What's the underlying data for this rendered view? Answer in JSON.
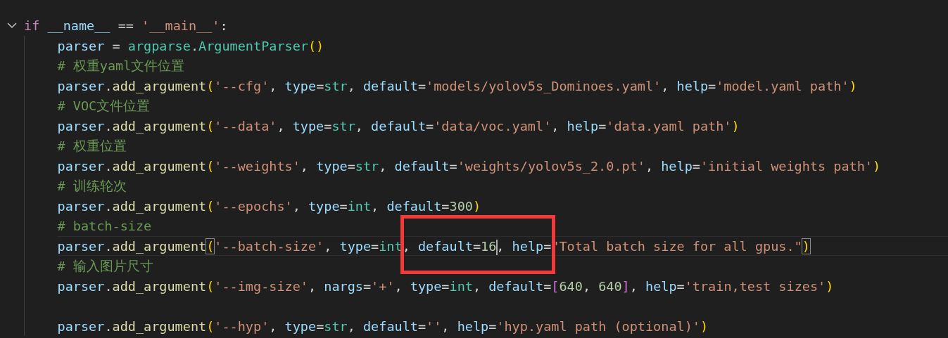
{
  "lines": [
    {
      "kind": "code",
      "expanded": true,
      "tokens": [
        {
          "text": "if",
          "kind": "keyword"
        },
        {
          "text": "__name__",
          "kind": "variable"
        },
        {
          "text": " == ",
          "kind": "op"
        },
        {
          "text": "'__main__'",
          "kind": "string"
        },
        {
          "text": ":",
          "kind": "op"
        }
      ],
      "children": [
        {
          "kind": "code",
          "tokens": [
            {
              "text": "parser",
              "kind": "variable"
            },
            {
              "text": " = ",
              "kind": "op"
            },
            {
              "text": "argparse",
              "kind": "class"
            },
            {
              "text": ".",
              "kind": "op"
            },
            {
              "text": "ArgumentParser",
              "kind": "class"
            },
            {
              "text": "()",
              "kind": "paren"
            }
          ]
        },
        {
          "kind": "code",
          "tokens": [
            {
              "text": "# 权重yaml文件位置",
              "kind": "comment"
            }
          ]
        },
        {
          "kind": "code",
          "tokens": [
            {
              "text": "parser",
              "kind": "variable"
            },
            {
              "text": ".",
              "kind": "op"
            },
            {
              "text": "add_argument",
              "kind": "function"
            },
            {
              "text": "(",
              "kind": "paren"
            },
            {
              "text": "'--cfg'",
              "kind": "string"
            },
            {
              "text": ", ",
              "kind": "op"
            },
            {
              "text": "type",
              "kind": "variable"
            },
            {
              "text": "=",
              "kind": "op"
            },
            {
              "text": "str",
              "kind": "class"
            },
            {
              "text": ", ",
              "kind": "op"
            },
            {
              "text": "default",
              "kind": "variable"
            },
            {
              "text": "=",
              "kind": "op"
            },
            {
              "text": "'models/yolov5s_Dominoes.yaml'",
              "kind": "string"
            },
            {
              "text": ", ",
              "kind": "op"
            },
            {
              "text": "help",
              "kind": "variable"
            },
            {
              "text": "=",
              "kind": "op"
            },
            {
              "text": "'model.yaml path'",
              "kind": "string"
            },
            {
              "text": ")",
              "kind": "paren"
            }
          ]
        },
        {
          "kind": "code",
          "tokens": [
            {
              "text": "# VOC文件位置",
              "kind": "comment"
            }
          ]
        },
        {
          "kind": "code",
          "tokens": [
            {
              "text": "parser",
              "kind": "variable"
            },
            {
              "text": ".",
              "kind": "op"
            },
            {
              "text": "add_argument",
              "kind": "function"
            },
            {
              "text": "(",
              "kind": "paren"
            },
            {
              "text": "'--data'",
              "kind": "string"
            },
            {
              "text": ", ",
              "kind": "op"
            },
            {
              "text": "type",
              "kind": "variable"
            },
            {
              "text": "=",
              "kind": "op"
            },
            {
              "text": "str",
              "kind": "class"
            },
            {
              "text": ", ",
              "kind": "op"
            },
            {
              "text": "default",
              "kind": "variable"
            },
            {
              "text": "=",
              "kind": "op"
            },
            {
              "text": "'data/voc.yaml'",
              "kind": "string"
            },
            {
              "text": ", ",
              "kind": "op"
            },
            {
              "text": "help",
              "kind": "variable"
            },
            {
              "text": "=",
              "kind": "op"
            },
            {
              "text": "'data.yaml path'",
              "kind": "string"
            },
            {
              "text": ")",
              "kind": "paren"
            }
          ]
        },
        {
          "kind": "code",
          "tokens": [
            {
              "text": "# 权重位置",
              "kind": "comment"
            }
          ]
        },
        {
          "kind": "code",
          "tokens": [
            {
              "text": "parser",
              "kind": "variable"
            },
            {
              "text": ".",
              "kind": "op"
            },
            {
              "text": "add_argument",
              "kind": "function"
            },
            {
              "text": "(",
              "kind": "paren"
            },
            {
              "text": "'--weights'",
              "kind": "string"
            },
            {
              "text": ", ",
              "kind": "op"
            },
            {
              "text": "type",
              "kind": "variable"
            },
            {
              "text": "=",
              "kind": "op"
            },
            {
              "text": "str",
              "kind": "class"
            },
            {
              "text": ", ",
              "kind": "op"
            },
            {
              "text": "default",
              "kind": "variable"
            },
            {
              "text": "=",
              "kind": "op"
            },
            {
              "text": "'weights/yolov5s_2.0.pt'",
              "kind": "string"
            },
            {
              "text": ", ",
              "kind": "op"
            },
            {
              "text": "help",
              "kind": "variable"
            },
            {
              "text": "=",
              "kind": "op"
            },
            {
              "text": "'initial weights path'",
              "kind": "string"
            },
            {
              "text": ")",
              "kind": "paren"
            }
          ]
        },
        {
          "kind": "code",
          "tokens": [
            {
              "text": "# 训练轮次",
              "kind": "comment"
            }
          ]
        },
        {
          "kind": "code",
          "tokens": [
            {
              "text": "parser",
              "kind": "variable"
            },
            {
              "text": ".",
              "kind": "op"
            },
            {
              "text": "add_argument",
              "kind": "function"
            },
            {
              "text": "(",
              "kind": "paren"
            },
            {
              "text": "'--epochs'",
              "kind": "string"
            },
            {
              "text": ", ",
              "kind": "op"
            },
            {
              "text": "type",
              "kind": "variable"
            },
            {
              "text": "=",
              "kind": "op"
            },
            {
              "text": "int",
              "kind": "class"
            },
            {
              "text": ", ",
              "kind": "op"
            },
            {
              "text": "default",
              "kind": "variable"
            },
            {
              "text": "=",
              "kind": "op"
            },
            {
              "text": "300",
              "kind": "number"
            },
            {
              "text": ")",
              "kind": "paren"
            }
          ]
        },
        {
          "kind": "code",
          "tokens": [
            {
              "text": "# batch-size",
              "kind": "comment"
            }
          ]
        },
        {
          "kind": "code",
          "current": true,
          "boxed": true,
          "tokens": [
            {
              "text": "parser",
              "kind": "variable"
            },
            {
              "text": ".",
              "kind": "op"
            },
            {
              "text": "add_argument",
              "kind": "function"
            },
            {
              "text": "(",
              "kind": "paren",
              "matched": true
            },
            {
              "text": "'--batch-size'",
              "kind": "string"
            },
            {
              "text": ", ",
              "kind": "op"
            },
            {
              "text": "type",
              "kind": "variable"
            },
            {
              "text": "=",
              "kind": "op"
            },
            {
              "text": "int",
              "kind": "class"
            },
            {
              "text": ", ",
              "kind": "op"
            },
            {
              "text": "default",
              "kind": "variable"
            },
            {
              "text": "=",
              "kind": "op"
            },
            {
              "text": "16",
              "kind": "number",
              "cursor": true
            },
            {
              "text": ", ",
              "kind": "op"
            },
            {
              "text": "help",
              "kind": "variable"
            },
            {
              "text": "=",
              "kind": "op"
            },
            {
              "text": "\"Total batch size for all gpus.\"",
              "kind": "string"
            },
            {
              "text": ")",
              "kind": "paren",
              "matched": true
            }
          ]
        },
        {
          "kind": "code",
          "tokens": [
            {
              "text": "# 输入图片尺寸",
              "kind": "comment"
            }
          ]
        },
        {
          "kind": "code",
          "tokens": [
            {
              "text": "parser",
              "kind": "variable"
            },
            {
              "text": ".",
              "kind": "op"
            },
            {
              "text": "add_argument",
              "kind": "function"
            },
            {
              "text": "(",
              "kind": "paren"
            },
            {
              "text": "'--img-size'",
              "kind": "string"
            },
            {
              "text": ", ",
              "kind": "op"
            },
            {
              "text": "nargs",
              "kind": "variable"
            },
            {
              "text": "=",
              "kind": "op"
            },
            {
              "text": "'+'",
              "kind": "string"
            },
            {
              "text": ", ",
              "kind": "op"
            },
            {
              "text": "type",
              "kind": "variable"
            },
            {
              "text": "=",
              "kind": "op"
            },
            {
              "text": "int",
              "kind": "class"
            },
            {
              "text": ", ",
              "kind": "op"
            },
            {
              "text": "default",
              "kind": "variable"
            },
            {
              "text": "=",
              "kind": "op"
            },
            {
              "text": "[",
              "kind": "bracket"
            },
            {
              "text": "640",
              "kind": "number"
            },
            {
              "text": ", ",
              "kind": "op"
            },
            {
              "text": "640",
              "kind": "number"
            },
            {
              "text": "]",
              "kind": "bracket"
            },
            {
              "text": ", ",
              "kind": "op"
            },
            {
              "text": "help",
              "kind": "variable"
            },
            {
              "text": "=",
              "kind": "op"
            },
            {
              "text": "'train,test sizes'",
              "kind": "string"
            },
            {
              "text": ")",
              "kind": "paren"
            }
          ]
        },
        {
          "kind": "blank"
        },
        {
          "kind": "code",
          "tokens": [
            {
              "text": "parser",
              "kind": "variable"
            },
            {
              "text": ".",
              "kind": "op"
            },
            {
              "text": "add_argument",
              "kind": "function"
            },
            {
              "text": "(",
              "kind": "paren"
            },
            {
              "text": "'--hyp'",
              "kind": "string"
            },
            {
              "text": ", ",
              "kind": "op"
            },
            {
              "text": "type",
              "kind": "variable"
            },
            {
              "text": "=",
              "kind": "op"
            },
            {
              "text": "str",
              "kind": "class"
            },
            {
              "text": ", ",
              "kind": "op"
            },
            {
              "text": "default",
              "kind": "variable"
            },
            {
              "text": "=",
              "kind": "op"
            },
            {
              "text": "''",
              "kind": "string"
            },
            {
              "text": ", ",
              "kind": "op"
            },
            {
              "text": "help",
              "kind": "variable"
            },
            {
              "text": "=",
              "kind": "op"
            },
            {
              "text": "'hyp.yaml path (optional)'",
              "kind": "string"
            },
            {
              "text": ")",
              "kind": "paren"
            }
          ]
        }
      ]
    }
  ]
}
